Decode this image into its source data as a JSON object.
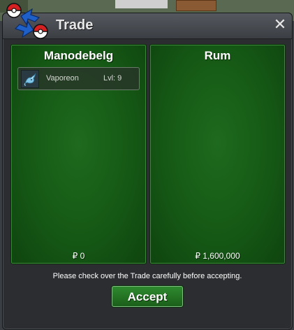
{
  "window": {
    "title": "Trade",
    "close_label": "✕"
  },
  "left_panel": {
    "player": "Manodebelg",
    "items": [
      {
        "name": "Vaporeon",
        "level": "Lvl: 9",
        "icon": "vaporeon-icon"
      }
    ],
    "money": "₽ 0"
  },
  "right_panel": {
    "player": "Rum",
    "items": [],
    "money": "₽ 1,600,000"
  },
  "footer": {
    "notice": "Please check over the Trade carefully before accepting.",
    "accept_label": "Accept"
  },
  "colors": {
    "panel_green": "#1a631a",
    "button_green": "#2e8a2e",
    "window_bg": "#2b2d30"
  }
}
